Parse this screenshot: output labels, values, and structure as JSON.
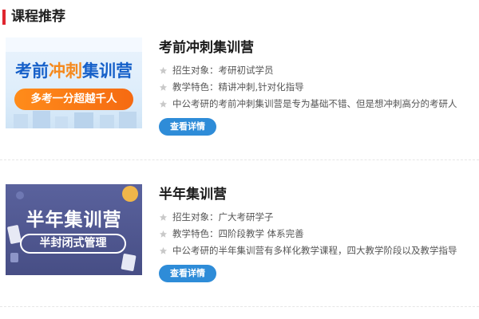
{
  "section": {
    "title": "课程推荐"
  },
  "courses": [
    {
      "title": "考前冲刺集训营",
      "thumbnail": {
        "title_part1": "考前",
        "title_part2": "冲刺",
        "title_part3": "集训营",
        "banner": "多考一分超越千人"
      },
      "targets": "招生对象：考研初试学员",
      "features": "教学特色：精讲冲刺,针对化指导",
      "description": "中公考研的考前冲刺集训营是专为基础不错、但是想冲刺高分的考研人",
      "button_label": "查看详情"
    },
    {
      "title": "半年集训营",
      "thumbnail": {
        "title": "半年集训营",
        "banner": "半封闭式管理"
      },
      "targets": "招生对象：广大考研学子",
      "features": "教学特色：四阶段教学 体系完善",
      "description": "中公考研的半年集训营有多样化教学课程，四大教学阶段以及教学指导",
      "button_label": "查看详情"
    }
  ],
  "colors": {
    "accent_red": "#e0262f",
    "button_blue": "#2e8cd8",
    "star_grey": "#c9c9c9"
  }
}
